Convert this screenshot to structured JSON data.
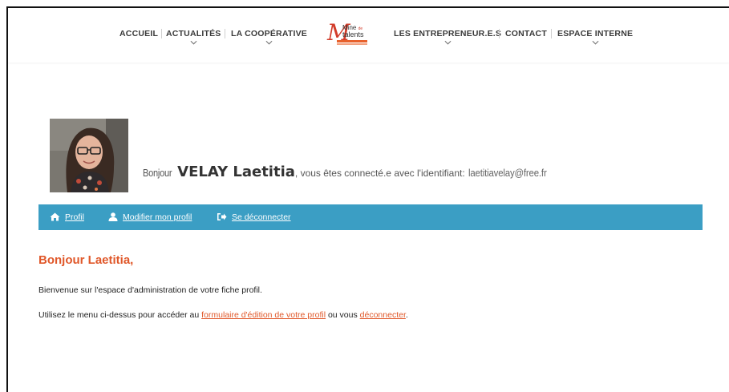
{
  "nav": {
    "items": [
      {
        "label": "ACCUEIL",
        "has_dropdown": false
      },
      {
        "label": "ACTUALITÉS",
        "has_dropdown": true
      },
      {
        "label": "LA COOPÉRATIVE",
        "has_dropdown": true
      },
      {
        "label": "LES ENTREPRENEUR.E.S",
        "has_dropdown": true
      },
      {
        "label": "CONTACT",
        "has_dropdown": false
      },
      {
        "label": "ESPACE INTERNE",
        "has_dropdown": true
      }
    ],
    "logo": {
      "letter": "M",
      "line1": "Mine",
      "line1_small": "de",
      "line2": "talents"
    }
  },
  "profile": {
    "hello": "Bonjour",
    "name": "VELAY Laetitia",
    "connected_text": ", vous êtes connecté.e avec l'identifiant:",
    "login": "laetitiavelay@free.fr"
  },
  "menu": {
    "items": [
      {
        "label": "Profil",
        "icon": "home-icon"
      },
      {
        "label": "Modifier mon profil",
        "icon": "user-icon"
      },
      {
        "label": "Se déconnecter",
        "icon": "sign-out-icon"
      }
    ],
    "bg_color": "#3b9ec4"
  },
  "content": {
    "title": "Bonjour Laetitia,",
    "paragraph1": "Bienvenue sur l'espace d'administration de votre fiche profil.",
    "paragraph2_before": "Utilisez le menu ci-dessus pour accéder au ",
    "paragraph2_link1": "formulaire d'édition de votre profil",
    "paragraph2_middle": " ou vous ",
    "paragraph2_link2": "déconnecter",
    "paragraph2_after": ".",
    "accent_color": "#e0582a"
  }
}
